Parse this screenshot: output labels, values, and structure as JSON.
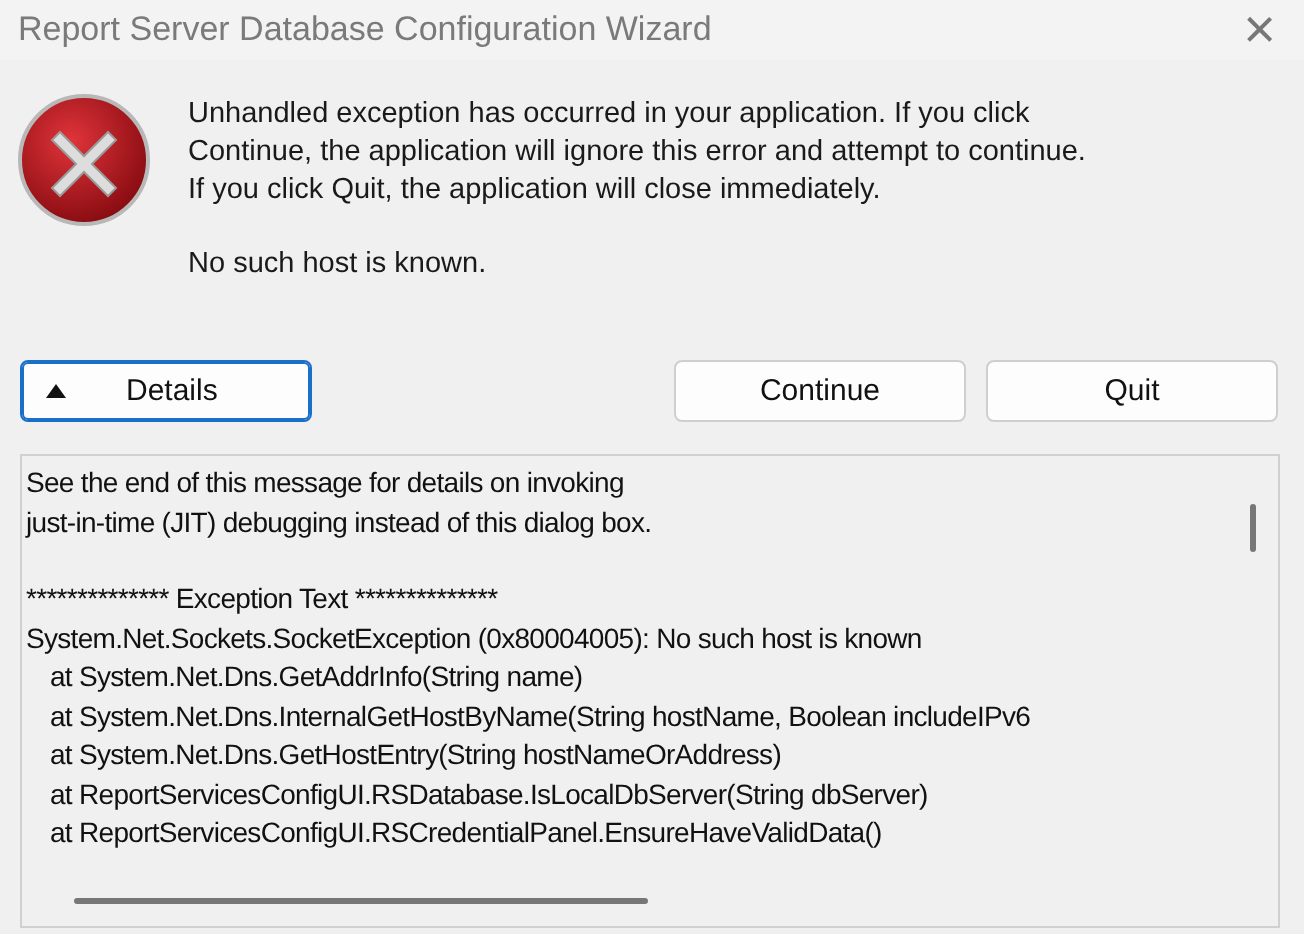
{
  "window": {
    "title": "Report Server Database Configuration Wizard",
    "close": "×"
  },
  "message": {
    "lines": [
      "Unhandled exception has occurred in your application. If you click",
      "Continue, the application will ignore this error and attempt to continue.",
      "If you click Quit, the application will close immediately."
    ],
    "detail": "No such host is known."
  },
  "details_button": {
    "label": "Details",
    "expanded": true
  },
  "buttons": [
    "Continue",
    "Quit"
  ],
  "details_text": [
    {
      "text": "See the end of this message for details on invoking",
      "kind": "text",
      "space_before": false
    },
    {
      "text": "just-in-time (JIT) debugging instead of this dialog box.",
      "kind": "text",
      "space_before": false
    },
    {
      "text": "************** Exception Text **************",
      "kind": "text",
      "space_before": true
    },
    {
      "text": "System.Net.Sockets.SocketException (0x80004005): No such host is known",
      "kind": "text",
      "space_before": false
    },
    {
      "text": "at System.Net.Dns.GetAddrInfo(String name)",
      "kind": "frame",
      "space_before": false
    },
    {
      "text": "at System.Net.Dns.InternalGetHostByName(String hostName, Boolean includeIPv6",
      "kind": "frame",
      "space_before": false
    },
    {
      "text": "at System.Net.Dns.GetHostEntry(String hostNameOrAddress)",
      "kind": "frame",
      "space_before": false
    },
    {
      "text": "at ReportServicesConfigUI.RSDatabase.IsLocalDbServer(String dbServer)",
      "kind": "frame",
      "space_before": false
    },
    {
      "text": "at ReportServicesConfigUI.RSCredentialPanel.EnsureHaveValidData()",
      "kind": "frame",
      "space_before": false
    }
  ]
}
